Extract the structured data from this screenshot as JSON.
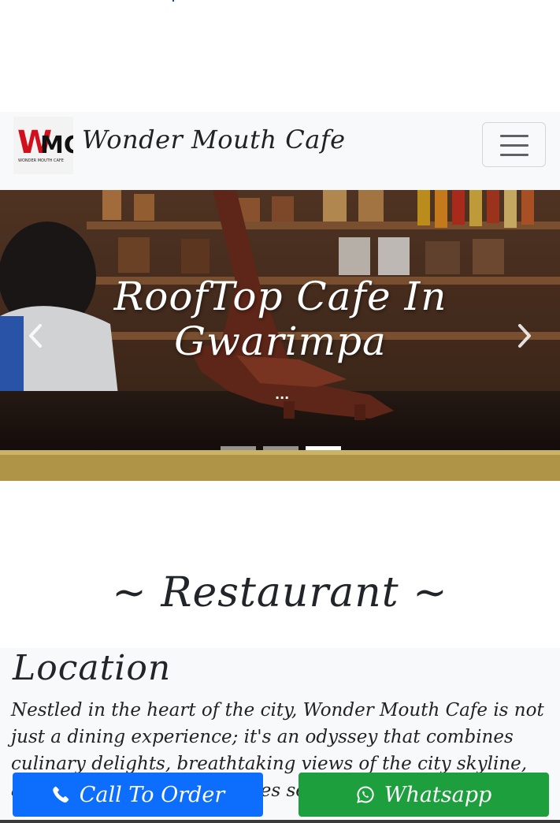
{
  "brand": {
    "name": "Wonder Mouth Cafe",
    "logo_text": "WMC",
    "logo_subtext": "WONDER MOUTH CAFE"
  },
  "navbar": {
    "toggler_icon": "hamburger-icon"
  },
  "carousel": {
    "caption": "RoofTop Cafe In Gwarimpa",
    "caption_more": "...",
    "prev_icon": "chevron-left-icon",
    "next_icon": "chevron-right-icon",
    "indicators": [
      {
        "active": false
      },
      {
        "active": false
      },
      {
        "active": true
      }
    ]
  },
  "section": {
    "title": "~ Restaurant ~"
  },
  "location": {
    "heading": "Location",
    "text": "Nestled in the heart of the city, Wonder Mouth Cafe is not just a dining experience; it's an odyssey that combines culinary delights, breathtaking views of the city skyline, and an ambiance that exudes sophistication and romance."
  },
  "actions": {
    "call_label": "Call To Order",
    "call_icon": "phone-icon",
    "whatsapp_label": "Whatsapp",
    "whatsapp_icon": "whatsapp-icon"
  },
  "colors": {
    "primary": "#0d6efd",
    "success": "#1e9f3e",
    "navbar_bg": "#f8f9fa",
    "logo_red": "#d0101c"
  }
}
